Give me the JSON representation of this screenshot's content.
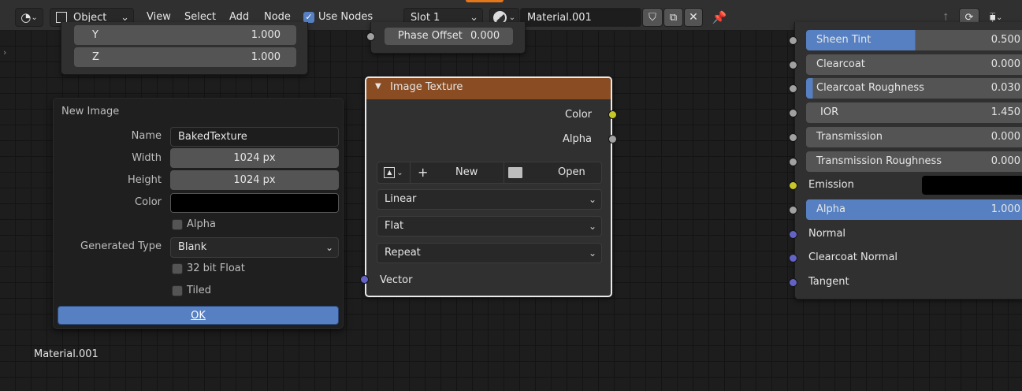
{
  "header": {
    "mode_label": "Object",
    "menus": [
      "View",
      "Select",
      "Add",
      "Node"
    ],
    "use_nodes_label": "Use Nodes",
    "use_nodes_checked": true,
    "slot_label": "Slot 1",
    "material_name": "Material.001"
  },
  "top_left_node": {
    "fields": [
      {
        "label": "Y",
        "value": "1.000"
      },
      {
        "label": "Z",
        "value": "1.000"
      }
    ]
  },
  "wave_node": {
    "phase_offset_label": "Phase Offset",
    "phase_offset_value": "0.000"
  },
  "new_image_popup": {
    "title": "New Image",
    "name_label": "Name",
    "name_value": "BakedTexture",
    "width_label": "Width",
    "width_value": "1024 px",
    "height_label": "Height",
    "height_value": "1024 px",
    "color_label": "Color",
    "color_value": "#000000",
    "alpha_label": "Alpha",
    "generated_type_label": "Generated Type",
    "generated_type_value": "Blank",
    "float_label": "32 bit Float",
    "tiled_label": "Tiled",
    "ok_label": "OK"
  },
  "image_texture_node": {
    "title": "Image Texture",
    "header_color": "#8a4d23",
    "outputs": [
      "Color",
      "Alpha"
    ],
    "new_label": "New",
    "open_label": "Open",
    "interpolation": "Linear",
    "projection": "Flat",
    "extension": "Repeat",
    "input_label": "Vector"
  },
  "principled_node": {
    "rows": [
      {
        "label": "Sheen Tint",
        "value": "0.500",
        "fill": 0.5,
        "socket": "grey"
      },
      {
        "label": "Clearcoat",
        "value": "0.000",
        "fill": 0.0,
        "socket": "grey"
      },
      {
        "label": "Clearcoat Roughness",
        "value": "0.030",
        "fill": 0.03,
        "socket": "grey"
      },
      {
        "label": "IOR",
        "value": "1.450",
        "fill": 0.0,
        "socket": "grey"
      },
      {
        "label": "Transmission",
        "value": "0.000",
        "fill": 0.0,
        "socket": "grey"
      },
      {
        "label": "Transmission Roughness",
        "value": "0.000",
        "fill": 0.0,
        "socket": "grey"
      },
      {
        "label": "Emission",
        "value": "#000000",
        "socket": "yellow"
      },
      {
        "label": "Alpha",
        "value": "1.000",
        "fill": 1.0,
        "socket": "grey"
      },
      {
        "label": "Normal",
        "socket": "blue"
      },
      {
        "label": "Clearcoat Normal",
        "socket": "blue"
      },
      {
        "label": "Tangent",
        "socket": "blue"
      }
    ]
  },
  "footer_material_name": "Material.001",
  "colors": {
    "accent": "#5680c2",
    "background": "#1d1d1d",
    "node_body": "#303030",
    "texture_header": "#8a4d23"
  }
}
